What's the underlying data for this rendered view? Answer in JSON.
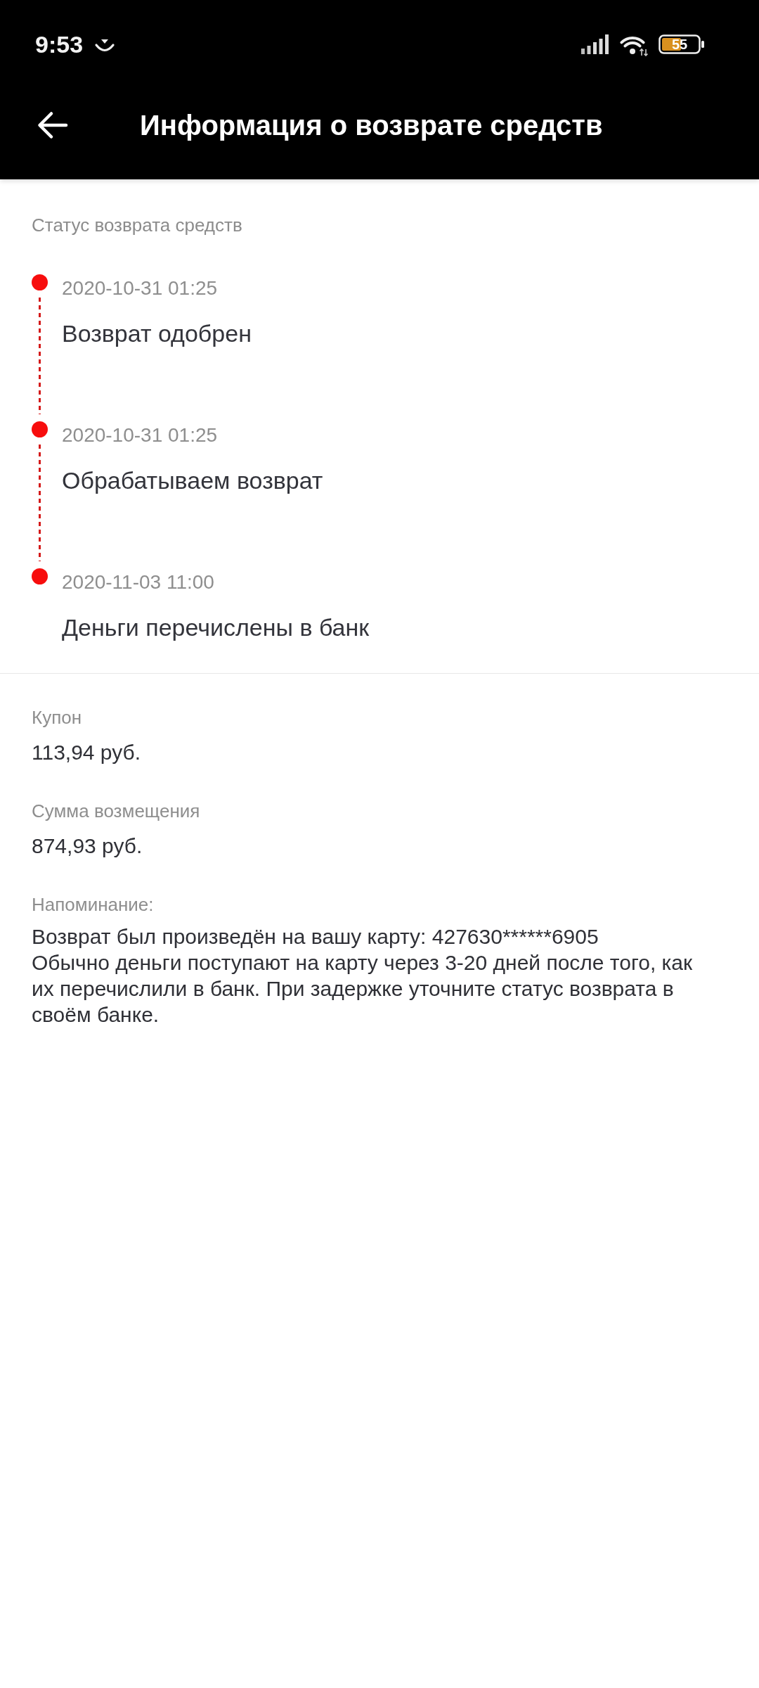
{
  "status_bar": {
    "time": "9:53",
    "battery": "55"
  },
  "header": {
    "title": "Информация о возврате средств"
  },
  "refund_status": {
    "label": "Статус возврата средств",
    "steps": [
      {
        "date": "2020-10-31 01:25",
        "title": "Возврат одобрен"
      },
      {
        "date": "2020-10-31 01:25",
        "title": "Обрабатываем возврат"
      },
      {
        "date": "2020-11-03 11:00",
        "title": "Деньги перечислены в банк"
      }
    ]
  },
  "details": [
    {
      "label": "Купон",
      "value": "113,94 руб."
    },
    {
      "label": "Сумма возмещения",
      "value": "874,93 руб."
    }
  ],
  "reminder": {
    "label": "Напоминание:",
    "text": "Возврат был произведён на вашу карту: 427630******6905\nОбычно деньги поступают на карту через 3-20 дней после того, как их перечислили в банк. При задержке уточните статус возврата в своём банке."
  }
}
